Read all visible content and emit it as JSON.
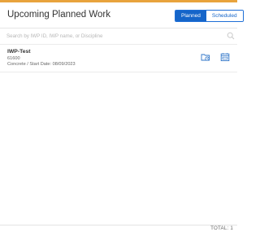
{
  "header": {
    "title": "Upcoming Planned Work",
    "toggle": {
      "active_label": "Planned",
      "inactive_label": "Scheduled"
    }
  },
  "search": {
    "placeholder": "Search by IWP ID, IWP name, or Discipline",
    "value": ""
  },
  "items": [
    {
      "title": "IWP-Test",
      "id": "61600",
      "meta": "Concrete / Start Date: 08/09/2023",
      "icons": [
        "folder-clock-icon",
        "calendar-icon"
      ]
    }
  ],
  "footer": {
    "total_text": "TOTAL:  1"
  },
  "colors": {
    "accent_top": "#e8a33d",
    "primary_blue": "#1565c9",
    "icon_blue": "#2f75c8"
  }
}
